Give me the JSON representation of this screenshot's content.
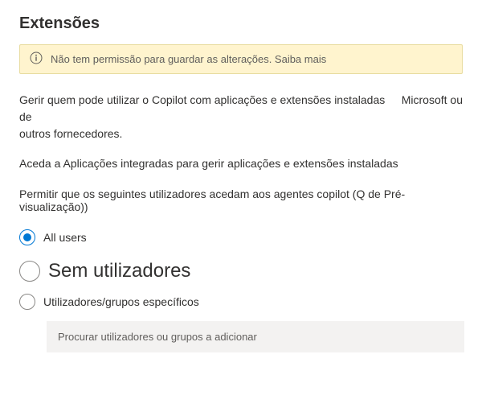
{
  "header": {
    "title": "Extensões"
  },
  "alert": {
    "text": "Não tem permissão para guardar as alterações. Saiba mais"
  },
  "description": {
    "line1_left": "Gerir quem pode utilizar o Copilot com aplicações e extensões instaladas de",
    "line1_right": "Microsoft ou",
    "line2": "outros fornecedores."
  },
  "integrated_apps": {
    "text": "Aceda a Aplicações integradas para gerir aplicações e extensões instaladas"
  },
  "permission_label": "Permitir que os seguintes utilizadores acedam aos agentes copilot (Q de Pré-visualização))",
  "radio": {
    "options": [
      {
        "id": "all",
        "label": "All users",
        "selected": true,
        "size": "small"
      },
      {
        "id": "none",
        "label": "Sem utilizadores",
        "selected": false,
        "size": "large"
      },
      {
        "id": "specific",
        "label": "Utilizadores/grupos específicos",
        "selected": false,
        "size": "small"
      }
    ]
  },
  "search": {
    "placeholder": "Procurar utilizadores ou grupos a adicionar"
  },
  "colors": {
    "accent": "#0078d4",
    "alert_bg": "#fff4ce"
  }
}
